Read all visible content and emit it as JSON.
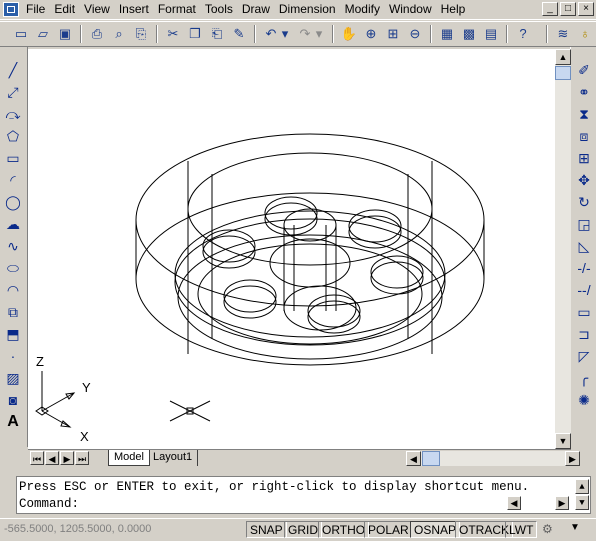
{
  "menubar": {
    "items": [
      "File",
      "Edit",
      "View",
      "Insert",
      "Format",
      "Tools",
      "Draw",
      "Dimension",
      "Modify",
      "Window",
      "Help"
    ],
    "window_controls": [
      "_",
      "□",
      "×"
    ]
  },
  "tabs": {
    "model": "Model",
    "layout1": "Layout1"
  },
  "ucs": {
    "z_label": "Z",
    "y_label": "Y",
    "x_label": "X"
  },
  "command": {
    "history_line": "Press ESC or ENTER to exit, or right-click to display shortcut menu.",
    "prompt": "Command:"
  },
  "status": {
    "coordinates": "-565.5000, 1205.5000, 0.0000",
    "toggles": [
      "SNAP",
      "GRID",
      "ORTHO",
      "POLAR",
      "OSNAP",
      "OTRACK",
      "LWT"
    ],
    "active_toggles": [
      "OSNAP"
    ]
  },
  "icons": {
    "toolbar": [
      "new-icon",
      "open-icon",
      "save-icon",
      "print-icon",
      "preview-icon",
      "plot-icon",
      "cut-icon",
      "copy-icon",
      "paste-icon",
      "matchprop-icon",
      "undo-icon",
      "redo-icon",
      "pan-icon",
      "zoom-realtime-icon",
      "zoom-window-icon",
      "zoom-previous-icon",
      "properties-icon",
      "designcenter-icon",
      "toolpalette-icon",
      "help-icon",
      "layers-icon",
      "bulb-icon"
    ],
    "draw": [
      "line-icon",
      "xline-icon",
      "polyline-icon",
      "polygon-icon",
      "rectangle-icon",
      "arc-icon",
      "circle-icon",
      "revcloud-icon",
      "spline-icon",
      "ellipse-icon",
      "ellipse-arc-icon",
      "insert-block-icon",
      "make-block-icon",
      "point-icon",
      "hatch-icon",
      "region-icon",
      "text-icon"
    ],
    "modify": [
      "erase-icon",
      "copy-object-icon",
      "mirror-icon",
      "offset-icon",
      "array-icon",
      "move-icon",
      "rotate-icon",
      "scale-icon",
      "stretch-icon",
      "trim-icon",
      "extend-icon",
      "break-icon",
      "join-icon",
      "chamfer-icon",
      "fillet-icon",
      "explode-icon"
    ]
  }
}
